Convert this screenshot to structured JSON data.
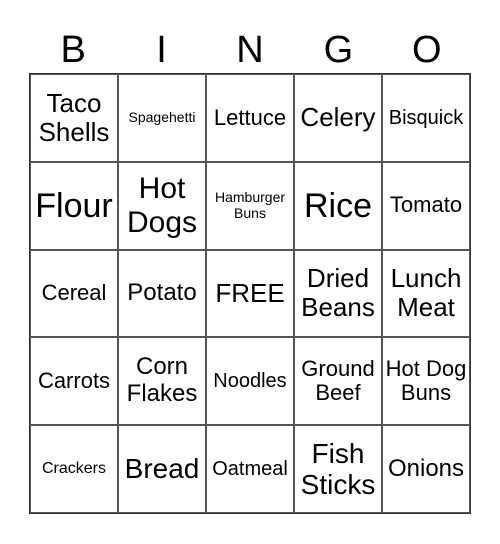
{
  "header": [
    "B",
    "I",
    "N",
    "G",
    "O"
  ],
  "cells": [
    [
      "Taco Shells",
      "Spagehetti",
      "Lettuce",
      "Celery",
      "Bisquick"
    ],
    [
      "Flour",
      "Hot Dogs",
      "Hamburger Buns",
      "Rice",
      "Tomato"
    ],
    [
      "Cereal",
      "Potato",
      "FREE",
      "Dried Beans",
      "Lunch Meat"
    ],
    [
      "Carrots",
      "Corn Flakes",
      "Noodles",
      "Ground Beef",
      "Hot Dog Buns"
    ],
    [
      "Crackers",
      "Bread",
      "Oatmeal",
      "Fish Sticks",
      "Onions"
    ]
  ]
}
